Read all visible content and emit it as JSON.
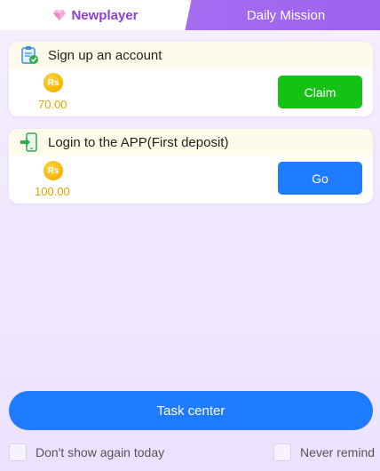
{
  "tabs": {
    "active": {
      "label": "Newplayer",
      "icon": "gem-icon"
    },
    "inactive": {
      "label": "Daily Mission"
    }
  },
  "tasks": [
    {
      "title": "Sign up an account",
      "icon": "clipboard-check-icon",
      "currency_symbol": "Rs",
      "amount": "70.00",
      "button": "Claim",
      "button_color": "#14c214"
    },
    {
      "title": "Login to the APP(First deposit)",
      "icon": "phone-login-icon",
      "currency_symbol": "Rs",
      "amount": "100.00",
      "button": "Go",
      "button_color": "#1f7bff"
    }
  ],
  "footer": {
    "task_center": "Task center",
    "dont_show": "Don't show again today",
    "never_remind": "Never remind"
  },
  "colors": {
    "accent_purple": "#8a3fd6",
    "tab_purple": "#a56cf0",
    "blue": "#1f7bff",
    "green": "#14c214",
    "gold": "#e6a300"
  }
}
